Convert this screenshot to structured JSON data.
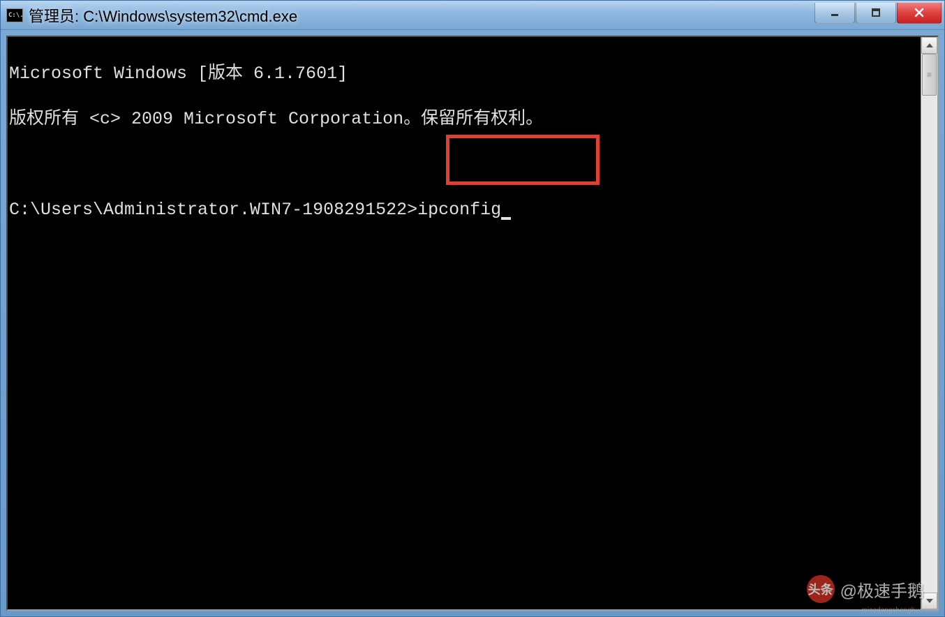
{
  "window": {
    "icon_text": "C:\\.",
    "title": "管理员: C:\\Windows\\system32\\cmd.exe"
  },
  "terminal": {
    "line1": "Microsoft Windows [版本 6.1.7601]",
    "line2": "版权所有 <c> 2009 Microsoft Corporation。保留所有权利。",
    "prompt": "C:\\Users\\Administrator.WIN7-1908291522>",
    "command": "ipconfig"
  },
  "watermark": {
    "logo_text": "头条",
    "text": "@极速手鹅",
    "sub": "miaodongshenghua.com"
  }
}
